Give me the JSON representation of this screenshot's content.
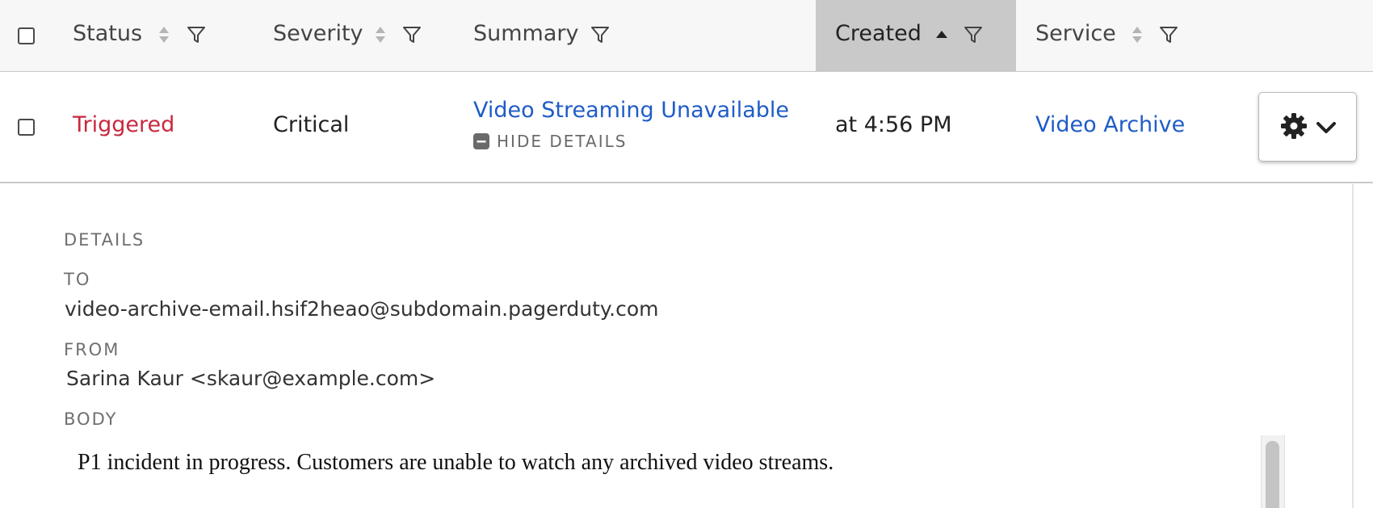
{
  "table": {
    "columns": {
      "status": "Status",
      "severity": "Severity",
      "summary": "Summary",
      "created": "Created",
      "service": "Service"
    },
    "sorted_column": "Created",
    "sort_direction": "ascending"
  },
  "row": {
    "status": "Triggered",
    "severity": "Critical",
    "summary": "Video Streaming Unavailable",
    "toggle_details": "HIDE DETAILS",
    "created": "at 4:56 PM",
    "service": "Video Archive"
  },
  "details": {
    "heading": "DETAILS",
    "to_label": "TO",
    "to_value": "video-archive-email.hsif2heao@subdomain.pagerduty.com",
    "from_label": "FROM",
    "from_value": "Sarina Kaur <skaur@example.com>",
    "body_label": "BODY",
    "body_value": "P1 incident in progress. Customers are unable to watch any archived video streams."
  },
  "colors": {
    "status_triggered": "#c9283e",
    "link": "#1f5cc7",
    "sorted_header_bg": "#c9c9c9"
  },
  "icons": [
    "sort-icon",
    "sort-ascending-icon",
    "filter-icon",
    "minus-square-icon",
    "gear-icon",
    "chevron-down-icon"
  ]
}
